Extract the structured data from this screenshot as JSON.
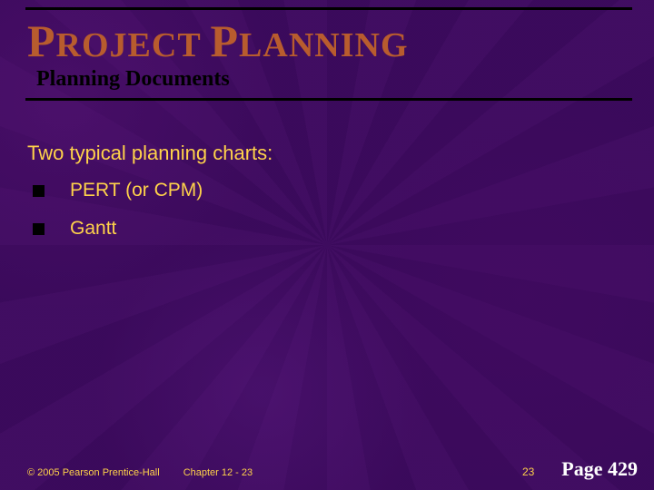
{
  "title": {
    "word1_cap": "P",
    "word1_rest": "ROJECT",
    "word2_cap": "P",
    "word2_rest": "LANNING"
  },
  "subtitle": "Planning Documents",
  "intro": "Two typical planning charts:",
  "bullets": [
    "PERT (or CPM)",
    "Gantt"
  ],
  "footer": {
    "copyright": "© 2005 Pearson Prentice-Hall",
    "chapter": "Chapter 12 - 23",
    "slide_number": "23",
    "page_label": "Page 429"
  }
}
